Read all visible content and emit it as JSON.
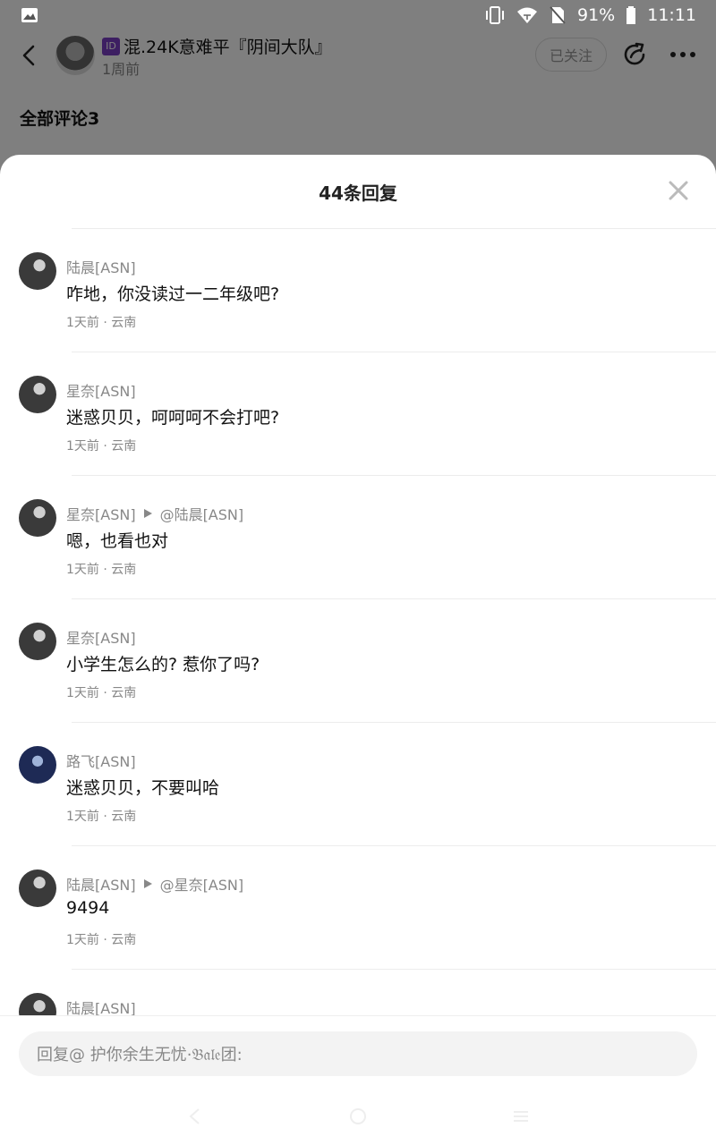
{
  "status_bar": {
    "battery": "91%",
    "time": "11:11"
  },
  "post_header": {
    "author_name": "混.24K意难平『阴间大队』",
    "id_badge": "ID",
    "post_time": "1周前",
    "follow_label": "已关注"
  },
  "comments_section": {
    "title": "全部评论3"
  },
  "replies_sheet": {
    "title": "44条回复",
    "replies": [
      {
        "user": "陆晨[ASN]",
        "reply_to": "",
        "text": "咋地，你没读过一二年级吧?",
        "meta": "1天前 · 云南"
      },
      {
        "user": "星奈[ASN]",
        "reply_to": "",
        "text": "迷惑贝贝，呵呵呵不会打吧?",
        "meta": "1天前 · 云南"
      },
      {
        "user": "星奈[ASN]",
        "reply_to": "@陆晨[ASN]",
        "text": "嗯，也看也对",
        "meta": "1天前 · 云南"
      },
      {
        "user": "星奈[ASN]",
        "reply_to": "",
        "text": "小学生怎么的? 惹你了吗?",
        "meta": "1天前 · 云南"
      },
      {
        "user": "路飞[ASN]",
        "reply_to": "",
        "text": "迷惑贝贝，不要叫哈",
        "meta": "1天前 · 云南"
      },
      {
        "user": "陆晨[ASN]",
        "reply_to": "@星奈[ASN]",
        "text": "9494",
        "meta": "1天前 · 云南"
      },
      {
        "user": "陆晨[ASN]",
        "reply_to": "",
        "text": "",
        "meta": ""
      }
    ],
    "reply_placeholder": "回复@ 护你余生无忧·𝔅𝔞𝔩𝔢团:"
  }
}
